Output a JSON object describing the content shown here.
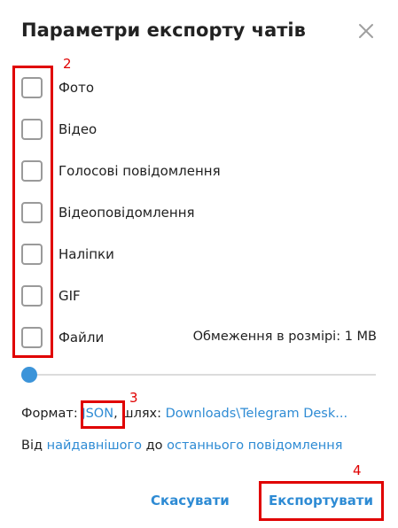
{
  "dialog": {
    "title": "Параметри експорту чатів"
  },
  "annotations": [
    "2",
    "3",
    "4"
  ],
  "options": [
    {
      "label": "Фото",
      "checked": false
    },
    {
      "label": "Відео",
      "checked": false
    },
    {
      "label": "Голосові повідомлення",
      "checked": false
    },
    {
      "label": "Відеоповідомлення",
      "checked": false
    },
    {
      "label": "Наліпки",
      "checked": false
    },
    {
      "label": "GIF",
      "checked": false
    },
    {
      "label": "Файли",
      "checked": false
    }
  ],
  "size_limit": {
    "label": "Обмеження в розмірі: 1 MB",
    "slider_fraction": 0
  },
  "format": {
    "prefix": "Формат:",
    "value": "JSON",
    "path_prefix": ", шлях:",
    "path": "Downloads\\Telegram Desk..."
  },
  "range": {
    "from_word": "Від",
    "from_link": "найдавнішого",
    "to_word": "до",
    "to_link": "останнього повідомлення"
  },
  "buttons": {
    "cancel": "Скасувати",
    "export": "Експортувати"
  },
  "colors": {
    "accent": "#2e8bd4",
    "annotation": "#e00000",
    "slider": "#3c94d9"
  }
}
